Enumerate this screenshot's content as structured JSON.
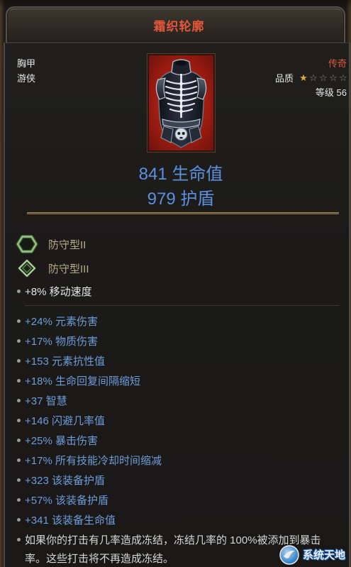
{
  "item": {
    "name": "霜织轮廓",
    "slot": "胸甲",
    "class": "游侠",
    "rarity": "传奇",
    "quality": {
      "label": "品质",
      "stars_filled": 1,
      "stars_total": 5
    },
    "level": "等级 56",
    "portrait_icon": "chest-armor-icon",
    "base_stats": [
      "841 生命值",
      "979 护盾"
    ]
  },
  "enchants": [
    {
      "icon": "hexagon-socket-icon",
      "label": "防守型II"
    },
    {
      "icon": "diamond-socket-icon",
      "label": "防守型III"
    }
  ],
  "implicit_affix": "+8% 移动速度",
  "affixes": [
    "+24% 元素伤害",
    "+17% 物质伤害",
    "+153 元素抗性值",
    "+18% 生命回复间隔缩短",
    "+37 智慧",
    "+146 闪避几率值",
    "+25% 暴击伤害",
    "+17% 所有技能冷却时间缩减",
    "+323 该装备护盾",
    "+57% 该装备护盾",
    "+341 该装备生命值"
  ],
  "legendary_affix": {
    "lines": [
      "如果你的打击有几率造成冻结，冻结几率的 100%被添加到暴击",
      "率。这些打击将不再造成冻结。"
    ]
  },
  "watermark": {
    "icon": "watermark-logo-icon",
    "text": "系统天地"
  },
  "colors": {
    "title": "#e0573a",
    "rarity": "#e0573a",
    "base_stat": "#5b91dc",
    "affix": "#6d9cd8",
    "enchant": "#b8aa88",
    "text": "#e6e6e6",
    "legendary_text": "#d6d6d6",
    "star_filled": "#e2aa33",
    "star_empty": "#8c8c8c"
  }
}
